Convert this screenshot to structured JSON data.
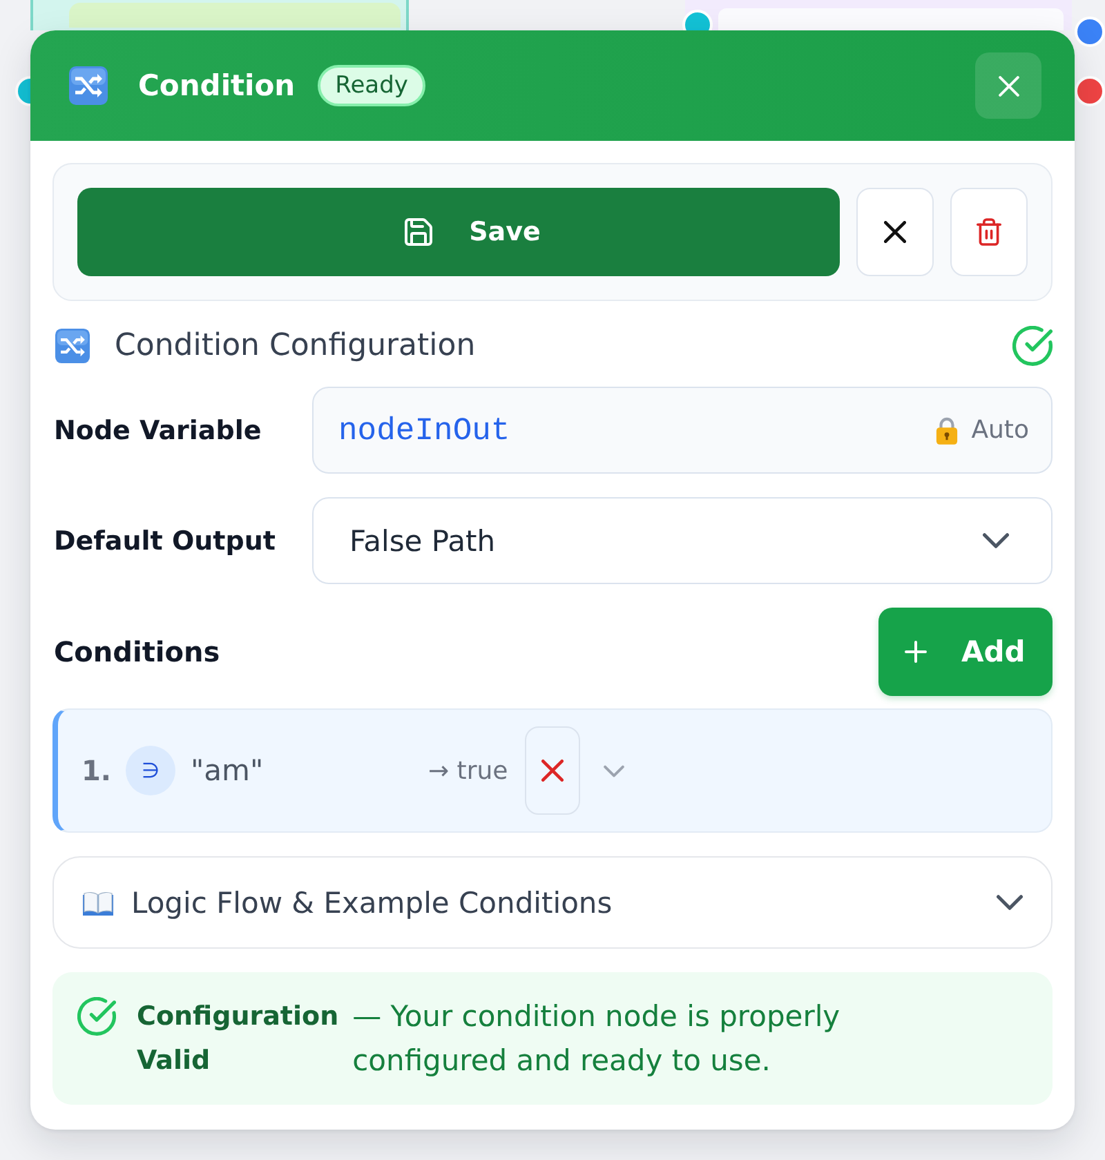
{
  "header": {
    "title": "Condition",
    "status": "Ready"
  },
  "actions": {
    "save_label": "Save"
  },
  "section": {
    "title": "Condition Configuration"
  },
  "fields": [
    {
      "kind": "readonly",
      "label": "Node Variable",
      "value": "nodeInOut",
      "suffix": "Auto"
    },
    {
      "kind": "select",
      "label": "Default Output",
      "value": "False Path"
    }
  ],
  "conditions": {
    "title": "Conditions",
    "add_label": "Add",
    "items": [
      {
        "number": "1.",
        "operator": "∋",
        "value": "\"am\"",
        "output": "→ true",
        "expanded": false
      }
    ]
  },
  "help": {
    "title": "Logic Flow & Example Conditions",
    "expanded": false
  },
  "validation": {
    "title": "Configuration Valid",
    "message": "— Your condition node is properly configured and ready to use."
  }
}
